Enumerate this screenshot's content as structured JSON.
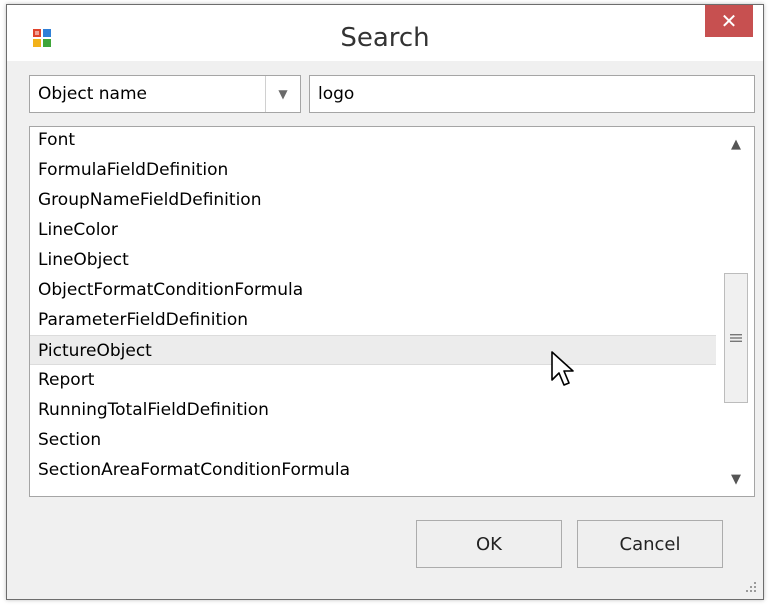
{
  "window": {
    "title": "Search",
    "close_glyph": "✕"
  },
  "filter": {
    "field_selected": "Object name",
    "search_value": "logo"
  },
  "results": {
    "items": [
      "Font",
      "FormulaFieldDefinition",
      "GroupNameFieldDefinition",
      "LineColor",
      "LineObject",
      "ObjectFormatConditionFormula",
      "ParameterFieldDefinition",
      "PictureObject",
      "Report",
      "RunningTotalFieldDefinition",
      "Section",
      "SectionAreaFormatConditionFormula"
    ],
    "selected_item": "PictureObject"
  },
  "buttons": {
    "ok_label": "OK",
    "cancel_label": "Cancel"
  },
  "icons": {
    "app": "app-window-icon",
    "close": "close-icon",
    "dropdown": "chevron-down-icon",
    "scroll_up": "arrow-up-icon",
    "scroll_down": "arrow-down-icon",
    "thumb_grip": "grip-lines-icon",
    "cursor": "mouse-pointer-icon",
    "resize": "resize-grip-icon"
  },
  "colors": {
    "close_button": "#c75050",
    "selected_row": "#ececec",
    "dialog_bg": "#f0f0f0"
  }
}
